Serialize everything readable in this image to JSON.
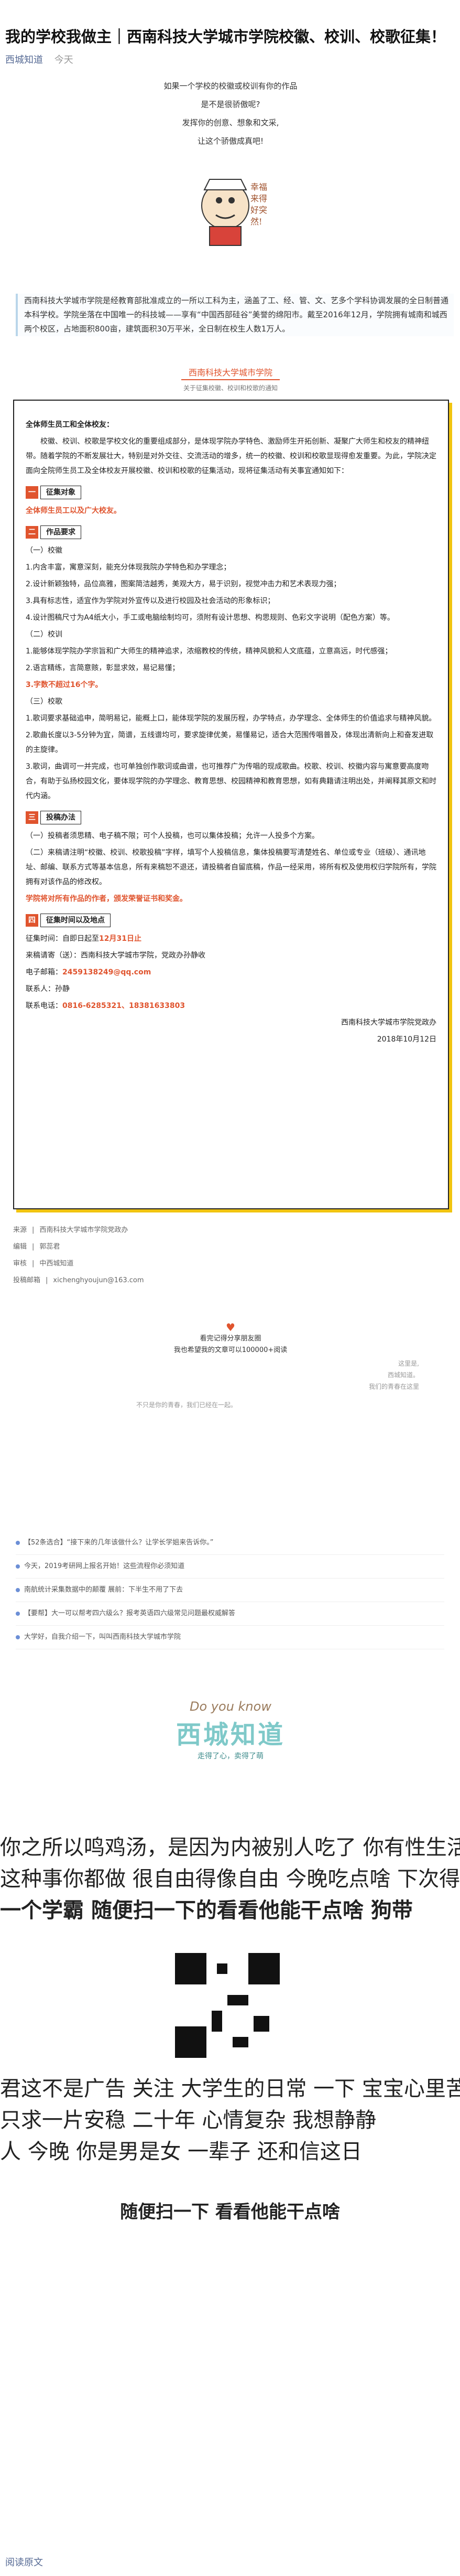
{
  "article": {
    "title": "我的学校我做主｜西南科技大学城市学院校徽、校训、校歌征集！",
    "author": "西城知道",
    "date": "今天"
  },
  "intro": {
    "lines": [
      "如果一个学校的校徽或校训有你的作品",
      "是不是很骄傲呢?",
      "发挥你的创意、想象和文采,",
      "让这个骄傲成真吧!"
    ],
    "mascot_text": "幸福来得好突然!"
  },
  "school_intro": "西南科技大学城市学院是经教育部批准成立的一所以工科为主，涵盖了工、经、管、文、艺多个学科协调发展的全日制普通本科学校。学院坐落在中国唯一的科技城——享有“中国西部硅谷”美誉的绵阳市。戴至2016年12月，学院拥有城南和城西两个校区，占地面积800亩，建筑面积30万平米，全日制在校生人数1万人。",
  "banner": {
    "title": "西南科技大学城市学院",
    "subtitle": "关于征集校徽、校训和校歌的通知"
  },
  "notice": {
    "greeting": "全体师生员工和全体校友：",
    "body": "校徽、校训、校歌是学校文化的重要组成部分，是体现学院办学特色、激励师生开拓创新、凝聚广大师生和校友的精神纽带。随着学院的不断发展壮大，特别是对外交往、交流活动的增多，统一的校徽、校训和校歌显现得愈发重要。为此，学院决定面向全院师生员工及全体校友开展校徽、校训和校歌的征集活动，现将征集活动有关事宜通知如下：",
    "sections": [
      {
        "num": "一",
        "label": "征集对象"
      },
      {
        "num": "二",
        "label": "作品要求"
      },
      {
        "num": "三",
        "label": "投稿办法"
      },
      {
        "num": "四",
        "label": "征集时间以及地点"
      }
    ],
    "target": "全体师生员工以及广大校友。",
    "emblem_title": "（一）校徽",
    "emblem_items": [
      "1.内含丰富，寓意深刻，能充分体现我院办学特色和办学理念；",
      "2.设计新颖独特，品位高雅，图案简洁越秀，美观大方，易于识别，视觉冲击力和艺术表现力强；",
      "3.具有标志性，适宜作为学院对外宣传以及进行校园及社会活动的形象标识；",
      "4.设计图稿尺寸为A4纸大小，手工或电脑绘制均可，须附有设计思想、构思规则、色彩文字说明（配色方案）等。"
    ],
    "motto_title": "（二）校训",
    "motto_items": [
      "1.能够体现学院办学宗旨和广大师生的精神追求，浓缩教校的传统，精神风貌和人文底蕴，立意高远，时代感强；",
      "2.语言精练，言简意赅，彰显求效，易记易懂；",
      "3.字数不超过16个字。"
    ],
    "song_title": "（三）校歌",
    "song_items": [
      "1.歌词要求基础追申，简明易记，能概上口，能体现学院的发展历程，办学特点，办学理念、全体师生的价值追求与精神风貌。",
      "2.歌曲长度以3-5分钟为宜，简谱，五线谱均可，要求旋律优美，易懂易记，适合大范围传唱普及，体现出清新向上和奋发进取的主旋律。",
      "3.歌词，曲调可一并完成，也可单独创作歌词或曲谱，也可推荐广为传唱的现成歌曲。校歌、校训、校徽内容与寓意要高度吻合，有助于弘扬校园文化，要体现学院的办学理念、教育思想、校园精神和教育思想，如有典籍请注明出处，并阐释其原文和时代内涵。"
    ],
    "submit_items": [
      "（一）投稿者须思精、电子稿不限；可个人投稿，也可以集体投稿；允许一人投多个方案。",
      "（二）来稿请注明“校徽、校训、校歌投稿”字样，填写个人投稿信息，集体投稿要写清楚姓名、单位或专业（班级）、通讯地址、邮编、联系方式等基本信息，所有来稿恕不退还，请投稿者自留底稿，作品一经采用，将所有权及使用权归学院所有，学院拥有对该作品的修改权。",
      "学院将对所有作品的作者，颁发荣誉证书和奖金。"
    ],
    "time_label": "征集时间：自即日起至",
    "time_value": "12月31日止",
    "address_label": "来稿请寄（送）：西南科技大学城市学院，党政办孙静收",
    "email_label": "电子邮箱：",
    "email_value": "2459138249@qq.com",
    "contact_label": "联系人：",
    "contact_value": "孙静",
    "phone_label": "联系电话：",
    "phone_value": "0816-6285321、18381633803",
    "signature": "西南科技大学城市学院党政办",
    "sign_date": "2018年10月12日"
  },
  "source": [
    {
      "label": "来源",
      "value": "西南科技大学城市学院党政办"
    },
    {
      "label": "编辑",
      "value": "郭蕊君"
    },
    {
      "label": "审核",
      "value": "中西城知道"
    },
    {
      "label": "投稿邮箱",
      "value": "xichenghyoujun@163.com"
    }
  ],
  "share": {
    "line1": "看完记得分享朋友圈",
    "line2": "我也希望我的文章可以100000+阅读"
  },
  "caption": {
    "line1": "这里是,",
    "line2": "西城知道。",
    "line3": "我们的青春在这里",
    "line4": "不只是你的青春，我们已经在一起。"
  },
  "related": [
    "【52条选合】“接下来的几年该做什么？让学长学姐来告诉你。”",
    "今天，2019考研网上报名开始！这些流程你必须知道",
    "南航统计采集数据中的颠覆 展前：下半生不用了下去",
    "【要帮】大一可以帮考四六级么？报考英语四六级常见问题最权威解答",
    "大学好，自我介绍一下，叫叫西南科技大学城市学院"
  ],
  "logo": {
    "do_you_know": "Do you know",
    "name": "西城知道",
    "slogan": "走得了心，卖得了萌"
  },
  "qr_section": {
    "lines": [
      "你之所以鸣鸡汤，是因为内被别人吃了 你有性生活吗 别笑",
      "这种事你都做 很自由得像自由 今晚吃点啥 下次得",
      "一个学霸 随便扫一下的看看他能干点啥 狗带",
      "君这不是广告 关注 大学生的日常 一下 宝宝心里苦",
      "只求一片安稳 二十年 心情复杂 我想静静",
      "人 今晚 你是男是女 一辈子 还和信这日"
    ],
    "headline": "随便扫一下 看看他能干点啥"
  },
  "footer": {
    "read_original": "阅读原文"
  }
}
